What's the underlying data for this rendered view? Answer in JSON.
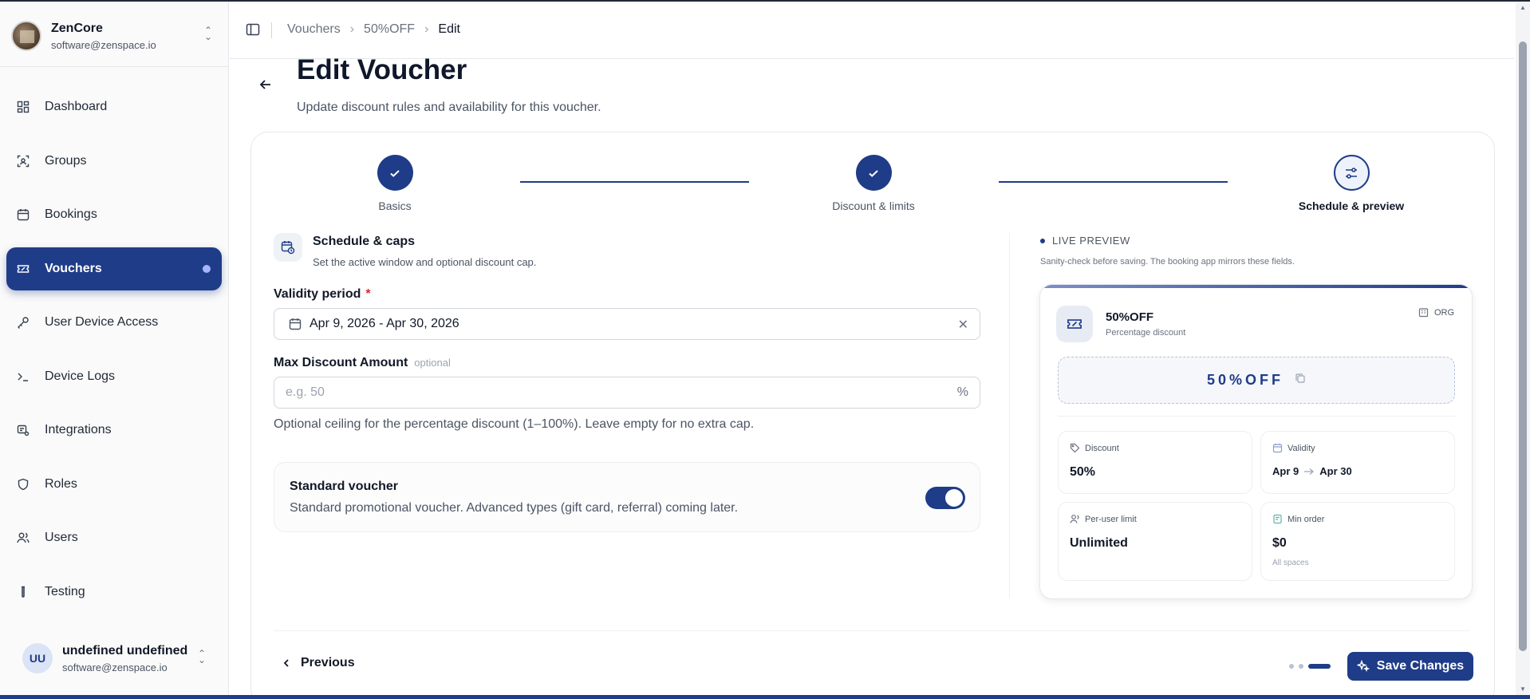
{
  "org": {
    "name": "ZenCore",
    "email": "software@zenspace.io"
  },
  "nav": {
    "items": [
      {
        "label": "Dashboard",
        "icon": "grid-icon"
      },
      {
        "label": "Groups",
        "icon": "scan-icon"
      },
      {
        "label": "Bookings",
        "icon": "calendar-icon"
      },
      {
        "label": "Vouchers",
        "icon": "ticket-icon",
        "active": true
      },
      {
        "label": "User Device Access",
        "icon": "key-icon"
      },
      {
        "label": "Device Logs",
        "icon": "terminal-icon"
      },
      {
        "label": "Integrations",
        "icon": "integration-icon"
      },
      {
        "label": "Roles",
        "icon": "shield-icon"
      },
      {
        "label": "Users",
        "icon": "users-icon"
      },
      {
        "label": "Testing",
        "icon": "test-tube-icon"
      }
    ]
  },
  "user": {
    "initials": "UU",
    "name": "undefined undefined",
    "email": "software@zenspace.io"
  },
  "breadcrumb": [
    "Vouchers",
    "50%OFF",
    "Edit"
  ],
  "page": {
    "title": "Edit Voucher",
    "subtitle": "Update discount rules and availability for this voucher."
  },
  "steps": [
    {
      "label": "Basics",
      "state": "done"
    },
    {
      "label": "Discount & limits",
      "state": "done"
    },
    {
      "label": "Schedule & preview",
      "state": "current"
    }
  ],
  "section": {
    "title": "Schedule & caps",
    "subtitle": "Set the active window and optional discount cap."
  },
  "validity": {
    "label": "Validity period",
    "required_mark": "*",
    "value": "Apr 9, 2026 - Apr 30, 2026",
    "clear": "✕"
  },
  "max_discount": {
    "label": "Max Discount Amount",
    "optional": "optional",
    "placeholder": "e.g. 50",
    "suffix": "%",
    "help": "Optional ceiling for the percentage discount (1–100%). Leave empty for no extra cap."
  },
  "standard": {
    "title": "Standard voucher",
    "subtitle": "Standard promotional voucher. Advanced types (gift card, referral) coming later.",
    "enabled": true
  },
  "preview": {
    "title": "LIVE PREVIEW",
    "subtitle": "Sanity-check before saving. The booking app mirrors these fields.",
    "code": "50%OFF",
    "type": "Percentage discount",
    "scope": "ORG",
    "coupon": "50%OFF",
    "discount_label": "Discount",
    "discount_value": "50%",
    "validity_label": "Validity",
    "validity_start": "Apr 9",
    "validity_end": "Apr 30",
    "per_user_label": "Per-user limit",
    "per_user_value": "Unlimited",
    "min_order_label": "Min order",
    "min_order_value": "$0",
    "min_order_note": "All spaces"
  },
  "footer": {
    "previous": "Previous",
    "save": "Save Changes"
  },
  "colors": {
    "accent": "#1f3c88",
    "required": "#dc2626"
  }
}
